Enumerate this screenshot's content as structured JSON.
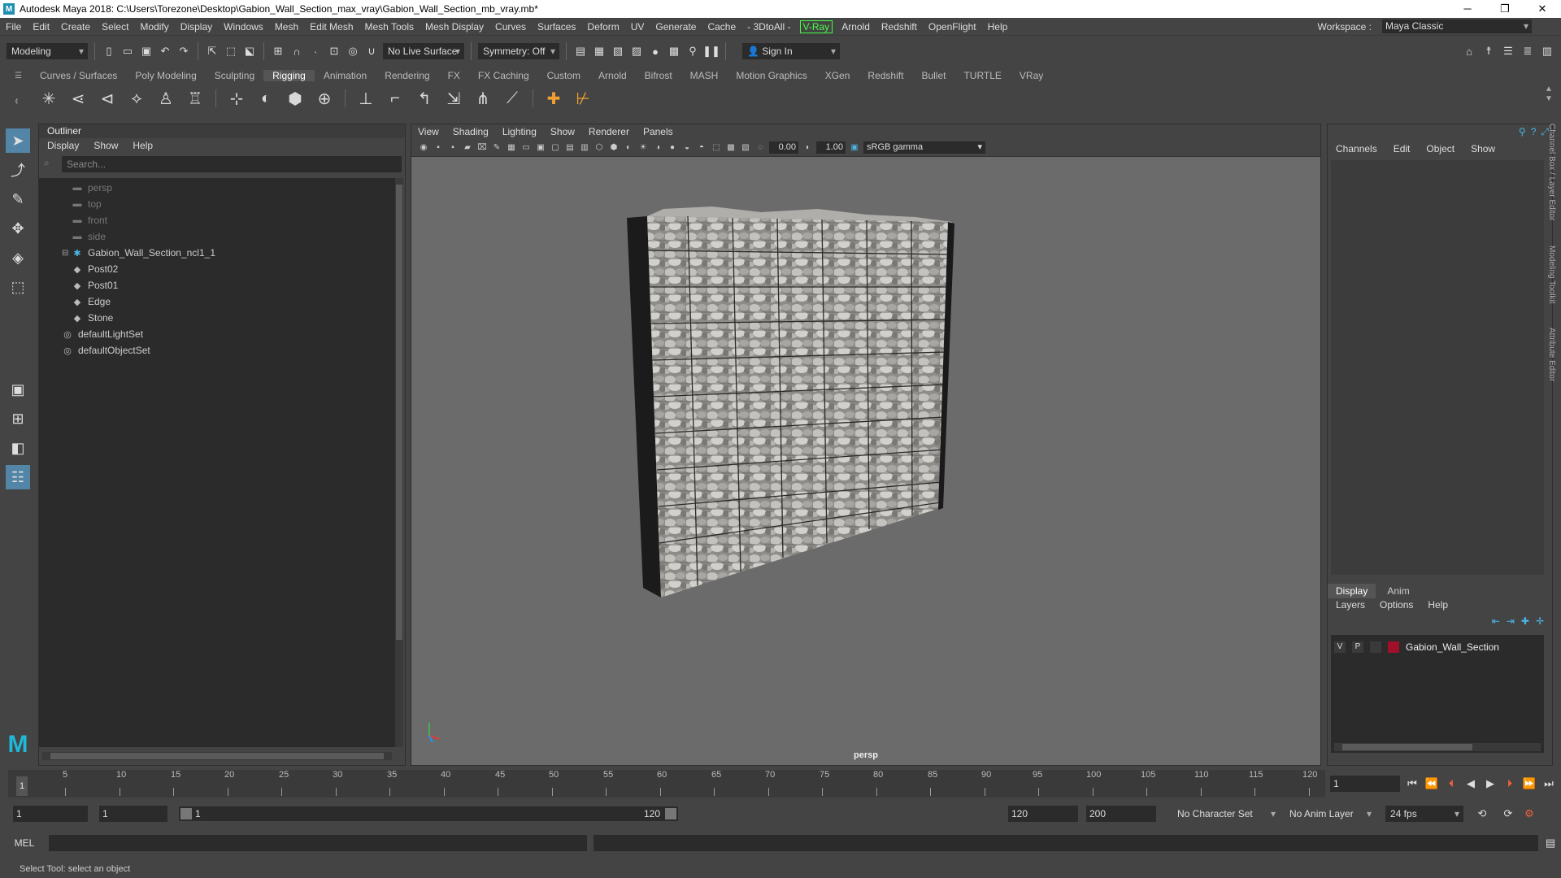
{
  "window": {
    "title": "Autodesk Maya 2018: C:\\Users\\Torezone\\Desktop\\Gabion_Wall_Section_max_vray\\Gabion_Wall_Section_mb_vray.mb*"
  },
  "menu": [
    "File",
    "Edit",
    "Create",
    "Select",
    "Modify",
    "Display",
    "Windows",
    "Mesh",
    "Edit Mesh",
    "Mesh Tools",
    "Mesh Display",
    "Curves",
    "Surfaces",
    "Deform",
    "UV",
    "Generate",
    "Cache",
    "- 3DtoAll -",
    "V-Ray",
    "Arnold",
    "Redshift",
    "OpenFlight",
    "Help"
  ],
  "workspace": {
    "label": "Workspace :",
    "value": "Maya Classic"
  },
  "toolbar": {
    "mode": "Modeling",
    "live_surface": "No Live Surface",
    "symmetry": "Symmetry: Off",
    "sign_in": "Sign In"
  },
  "shelf_tabs": [
    "Curves / Surfaces",
    "Poly Modeling",
    "Sculpting",
    "Rigging",
    "Animation",
    "Rendering",
    "FX",
    "FX Caching",
    "Custom",
    "Arnold",
    "Bifrost",
    "MASH",
    "Motion Graphics",
    "XGen",
    "Redshift",
    "Bullet",
    "TURTLE",
    "VRay"
  ],
  "active_shelf": "Rigging",
  "outliner": {
    "title": "Outliner",
    "menu": [
      "Display",
      "Show",
      "Help"
    ],
    "search_placeholder": "Search...",
    "items": [
      {
        "label": "persp",
        "icon": "camera-icon",
        "dim": true
      },
      {
        "label": "top",
        "icon": "camera-icon",
        "dim": true
      },
      {
        "label": "front",
        "icon": "camera-icon",
        "dim": true
      },
      {
        "label": "side",
        "icon": "camera-icon",
        "dim": true
      },
      {
        "label": "Gabion_Wall_Section_ncl1_1",
        "icon": "group-icon",
        "dim": false
      },
      {
        "label": "Post02",
        "icon": "mesh-icon",
        "dim": false
      },
      {
        "label": "Post01",
        "icon": "mesh-icon",
        "dim": false
      },
      {
        "label": "Edge",
        "icon": "mesh-icon",
        "dim": false
      },
      {
        "label": "Stone",
        "icon": "mesh-icon",
        "dim": false
      },
      {
        "label": "defaultLightSet",
        "icon": "set-icon",
        "dim": false
      },
      {
        "label": "defaultObjectSet",
        "icon": "set-icon",
        "dim": false
      }
    ]
  },
  "viewport": {
    "menu": [
      "View",
      "Shading",
      "Lighting",
      "Show",
      "Renderer",
      "Panels"
    ],
    "exposure": "0.00",
    "gamma_value": "1.00",
    "color_space": "sRGB gamma",
    "camera": "persp"
  },
  "channel_box": {
    "menu": [
      "Channels",
      "Edit",
      "Object",
      "Show"
    ],
    "tabs": [
      "Display",
      "Anim"
    ],
    "layer_menu": [
      "Layers",
      "Options",
      "Help"
    ],
    "layer": {
      "v": "V",
      "p": "P",
      "name": "Gabion_Wall_Section",
      "color": "#a0102a"
    }
  },
  "side_tabs": [
    "Channel Box / Layer Editor",
    "Modeling Toolkit",
    "Attribute Editor"
  ],
  "timeline": {
    "ticks": [
      "5",
      "10",
      "15",
      "20",
      "25",
      "30",
      "35",
      "40",
      "45",
      "50",
      "55",
      "60",
      "65",
      "70",
      "75",
      "80",
      "85",
      "90",
      "95",
      "100",
      "105",
      "110",
      "115",
      "120"
    ],
    "current": "1",
    "frame_field": "1"
  },
  "range": {
    "start": "1",
    "inner_start": "1",
    "slider_start": "1",
    "slider_end": "120",
    "end": "120",
    "max": "200",
    "character_set": "No Character Set",
    "anim_layer": "No Anim Layer",
    "fps": "24 fps"
  },
  "command": {
    "label": "MEL"
  },
  "status": "Select Tool: select an object"
}
